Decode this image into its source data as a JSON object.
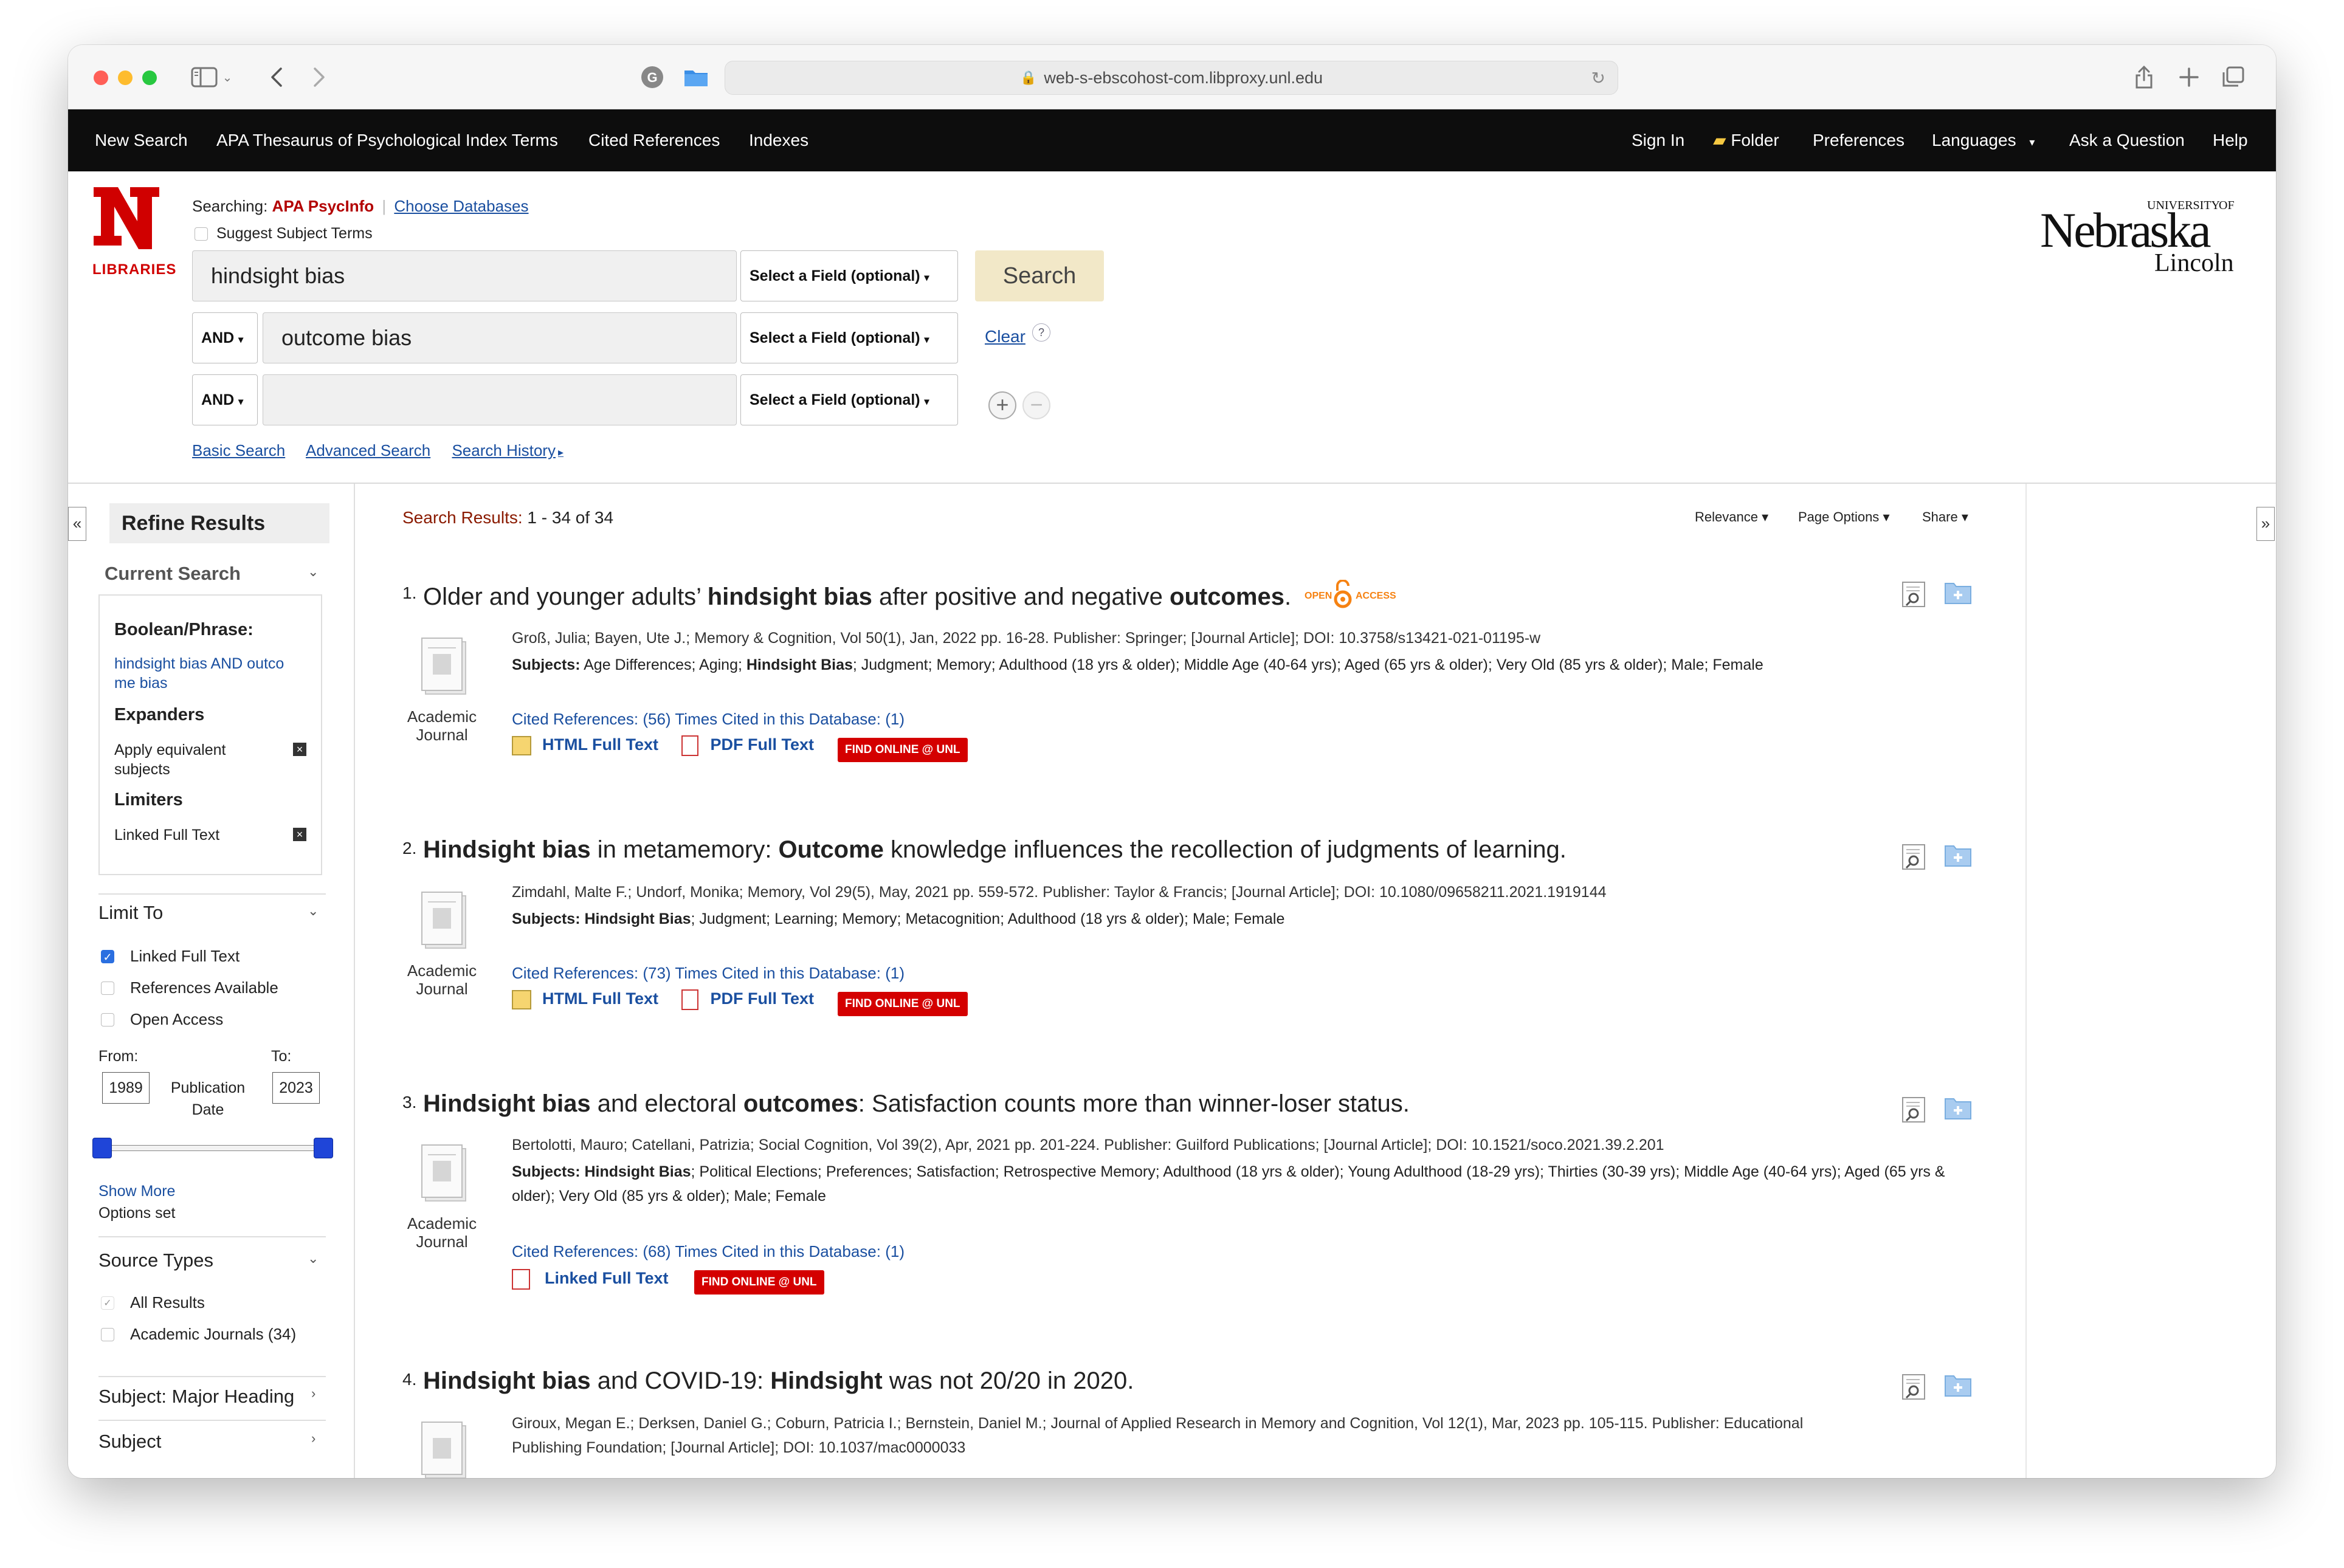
{
  "browser": {
    "url": "web-s-ebscohost-com.libproxy.unl.edu"
  },
  "topnav": {
    "left": [
      "New Search",
      "APA Thesaurus of Psychological Index Terms",
      "Cited References",
      "Indexes"
    ],
    "right": [
      "Sign In",
      "Folder",
      "Preferences",
      "Languages",
      "Ask a Question",
      "Help"
    ]
  },
  "logo": {
    "lib_text": "LIBRARIES",
    "unl_university": "UNIVERSITY",
    "unl_of": "OF",
    "unl_name": "Nebraska",
    "unl_city": "Lincoln"
  },
  "search": {
    "searching_label": "Searching:",
    "database": "APA PsycInfo",
    "choose_db": "Choose Databases",
    "suggest": "Suggest Subject Terms",
    "row1_value": "hindsight bias",
    "row2_op": "AND",
    "row2_value": "outcome bias",
    "row3_op": "AND",
    "row3_value": "",
    "field_select": "Select a Field (optional)",
    "search_button": "Search",
    "clear": "Clear",
    "help": "?",
    "basic": "Basic Search",
    "advanced": "Advanced Search",
    "history": "Search History"
  },
  "sidebar": {
    "collapse": "«",
    "expand": "»",
    "title": "Refine Results",
    "current_search": "Current Search",
    "boolean_heading": "Boolean/Phrase:",
    "boolean_value_1": "hindsight bias AND outco",
    "boolean_value_2": "me bias",
    "expanders": "Expanders",
    "expander_1a": "Apply equivalent",
    "expander_1b": "subjects",
    "limiters": "Limiters",
    "limiter_1": "Linked Full Text",
    "limit_to": "Limit To",
    "limit_options": [
      {
        "label": "Linked Full Text",
        "checked": true
      },
      {
        "label": "References Available",
        "checked": false
      },
      {
        "label": "Open Access",
        "checked": false
      }
    ],
    "from_label": "From:",
    "to_label": "To:",
    "from_value": "1989",
    "to_value": "2023",
    "pub_date_1": "Publication",
    "pub_date_2": "Date",
    "show_more": "Show More",
    "options_set": "Options set",
    "source_types": "Source Types",
    "source_options": [
      "All Results",
      "Academic Journals (34)"
    ],
    "subject_major": "Subject: Major Heading",
    "subject": "Subject"
  },
  "results": {
    "header_label": "Search Results:",
    "header_count": "1 - 34 of 34",
    "sort": "Relevance",
    "page_options": "Page Options",
    "share": "Share",
    "type_1": "Academic",
    "type_2": "Journal",
    "cited_refs": "Cited References:",
    "times_cited": "Times Cited in this Database:",
    "html_full_text": "HTML Full Text",
    "pdf_full_text": "PDF Full Text",
    "linked_full_text": "Linked Full Text",
    "find_online": "FIND ONLINE @ UNL",
    "subjects_label": "Subjects:",
    "oa_open": "OPEN",
    "oa_access": "ACCESS",
    "items": [
      {
        "num": "1.",
        "title_parts": [
          "Older and younger adults’ ",
          "hindsight bias",
          " after positive and negative ",
          "outcomes",
          "."
        ],
        "meta": "Groß, Julia; Bayen, Ute J.; Memory & Cognition, Vol 50(1), Jan, 2022 pp. 16-28. Publisher: Springer; [Journal Article]; DOI: 10.3758/s13421-021-01195-w",
        "subjects_a": "Age Differences; Aging; ",
        "subjects_b": "Hindsight Bias",
        "subjects_c": "; Judgment; Memory; Adulthood (18 yrs & older); Middle Age (40-64 yrs); Aged (65 yrs & older); Very Old (85 yrs & older); Male; Female",
        "cited": "(56)",
        "times": "(1)"
      },
      {
        "num": "2.",
        "title_parts": [
          "Hindsight bias",
          " in metamemory: ",
          "Outcome",
          " knowledge influences the recollection of judgments of learning.",
          ""
        ],
        "meta": "Zimdahl, Malte F.; Undorf, Monika; Memory, Vol 29(5), May, 2021 pp. 559-572. Publisher: Taylor & Francis; [Journal Article]; DOI: 10.1080/09658211.2021.1919144",
        "subjects_a": "",
        "subjects_b": "Hindsight Bias",
        "subjects_c": "; Judgment; Learning; Memory; Metacognition; Adulthood (18 yrs & older); Male; Female",
        "cited": "(73)",
        "times": "(1)"
      },
      {
        "num": "3.",
        "title_parts": [
          "Hindsight bias",
          " and electoral ",
          "outcomes",
          ": Satisfaction counts more than winner-loser status.",
          ""
        ],
        "meta": "Bertolotti, Mauro; Catellani, Patrizia; Social Cognition, Vol 39(2), Apr, 2021 pp. 201-224. Publisher: Guilford Publications; [Journal Article]; DOI: 10.1521/soco.2021.39.2.201",
        "subjects_a": "",
        "subjects_b": "Hindsight Bias",
        "subjects_c": "; Political Elections; Preferences; Satisfaction; Retrospective Memory; Adulthood (18 yrs & older); Young Adulthood (18-29 yrs); Thirties (30-39 yrs); Middle Age (40-64 yrs); Aged (65 yrs & older); Very Old (85 yrs & older); Male; Female",
        "cited": "(68)",
        "times": "(1)"
      },
      {
        "num": "4.",
        "title_parts": [
          "Hindsight bias",
          " and COVID-19: ",
          "Hindsight",
          " was not 20/20 in 2020.",
          ""
        ],
        "meta_1": "Giroux, Megan E.; Derksen, Daniel G.; Coburn, Patricia I.; Bernstein, Daniel M.; Journal of Applied Research in Memory and Cognition, Vol 12(1), Mar, 2023 pp. 105-115. Publisher: Educational",
        "meta_2": "Publishing Foundation; [Journal Article]; DOI: 10.1037/mac0000033"
      }
    ]
  }
}
